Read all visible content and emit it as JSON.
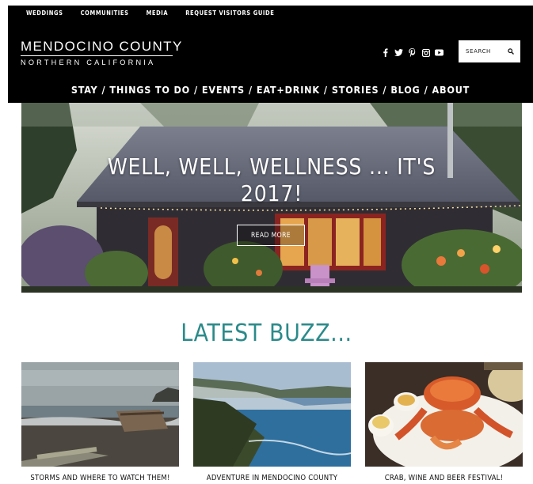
{
  "topbar": {
    "links": [
      "WEDDINGS",
      "COMMUNITIES",
      "MEDIA",
      "REQUEST VISITORS GUIDE"
    ]
  },
  "logo": {
    "main": "MENDOCINO COUNTY",
    "sub": "NORTHERN CALIFORNIA"
  },
  "social": {
    "icons": [
      "facebook-icon",
      "twitter-icon",
      "pinterest-icon",
      "instagram-icon",
      "youtube-icon"
    ]
  },
  "search": {
    "placeholder": "SEARCH"
  },
  "nav": {
    "items": [
      "STAY",
      "THINGS TO DO",
      "EVENTS",
      "EAT+DRINK",
      "STORIES",
      "BLOG",
      "ABOUT"
    ],
    "separator": "/"
  },
  "hero": {
    "title_line1": "WELL, WELL, WELLNESS ... IT'S",
    "title_line2": "2017!",
    "button_label": "READ MORE"
  },
  "buzz": {
    "title": "LATEST BUZZ...",
    "cards": [
      {
        "caption": "STORMS AND WHERE TO WATCH THEM!"
      },
      {
        "caption": "ADVENTURE IN MENDOCINO COUNTY"
      },
      {
        "caption": "CRAB, WINE AND BEER FESTIVAL!"
      }
    ]
  },
  "colors": {
    "header_bg": "#000000",
    "accent_teal": "#2b8a8a",
    "text_white": "#ffffff"
  }
}
